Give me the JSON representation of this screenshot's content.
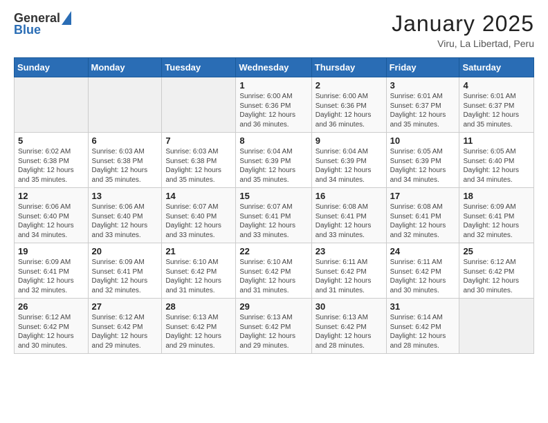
{
  "header": {
    "logo_general": "General",
    "logo_blue": "Blue",
    "month": "January 2025",
    "location": "Viru, La Libertad, Peru"
  },
  "weekdays": [
    "Sunday",
    "Monday",
    "Tuesday",
    "Wednesday",
    "Thursday",
    "Friday",
    "Saturday"
  ],
  "weeks": [
    [
      {
        "day": "",
        "info": ""
      },
      {
        "day": "",
        "info": ""
      },
      {
        "day": "",
        "info": ""
      },
      {
        "day": "1",
        "info": "Sunrise: 6:00 AM\nSunset: 6:36 PM\nDaylight: 12 hours and 36 minutes."
      },
      {
        "day": "2",
        "info": "Sunrise: 6:00 AM\nSunset: 6:36 PM\nDaylight: 12 hours and 36 minutes."
      },
      {
        "day": "3",
        "info": "Sunrise: 6:01 AM\nSunset: 6:37 PM\nDaylight: 12 hours and 35 minutes."
      },
      {
        "day": "4",
        "info": "Sunrise: 6:01 AM\nSunset: 6:37 PM\nDaylight: 12 hours and 35 minutes."
      }
    ],
    [
      {
        "day": "5",
        "info": "Sunrise: 6:02 AM\nSunset: 6:38 PM\nDaylight: 12 hours and 35 minutes."
      },
      {
        "day": "6",
        "info": "Sunrise: 6:03 AM\nSunset: 6:38 PM\nDaylight: 12 hours and 35 minutes."
      },
      {
        "day": "7",
        "info": "Sunrise: 6:03 AM\nSunset: 6:38 PM\nDaylight: 12 hours and 35 minutes."
      },
      {
        "day": "8",
        "info": "Sunrise: 6:04 AM\nSunset: 6:39 PM\nDaylight: 12 hours and 35 minutes."
      },
      {
        "day": "9",
        "info": "Sunrise: 6:04 AM\nSunset: 6:39 PM\nDaylight: 12 hours and 34 minutes."
      },
      {
        "day": "10",
        "info": "Sunrise: 6:05 AM\nSunset: 6:39 PM\nDaylight: 12 hours and 34 minutes."
      },
      {
        "day": "11",
        "info": "Sunrise: 6:05 AM\nSunset: 6:40 PM\nDaylight: 12 hours and 34 minutes."
      }
    ],
    [
      {
        "day": "12",
        "info": "Sunrise: 6:06 AM\nSunset: 6:40 PM\nDaylight: 12 hours and 34 minutes."
      },
      {
        "day": "13",
        "info": "Sunrise: 6:06 AM\nSunset: 6:40 PM\nDaylight: 12 hours and 33 minutes."
      },
      {
        "day": "14",
        "info": "Sunrise: 6:07 AM\nSunset: 6:40 PM\nDaylight: 12 hours and 33 minutes."
      },
      {
        "day": "15",
        "info": "Sunrise: 6:07 AM\nSunset: 6:41 PM\nDaylight: 12 hours and 33 minutes."
      },
      {
        "day": "16",
        "info": "Sunrise: 6:08 AM\nSunset: 6:41 PM\nDaylight: 12 hours and 33 minutes."
      },
      {
        "day": "17",
        "info": "Sunrise: 6:08 AM\nSunset: 6:41 PM\nDaylight: 12 hours and 32 minutes."
      },
      {
        "day": "18",
        "info": "Sunrise: 6:09 AM\nSunset: 6:41 PM\nDaylight: 12 hours and 32 minutes."
      }
    ],
    [
      {
        "day": "19",
        "info": "Sunrise: 6:09 AM\nSunset: 6:41 PM\nDaylight: 12 hours and 32 minutes."
      },
      {
        "day": "20",
        "info": "Sunrise: 6:09 AM\nSunset: 6:41 PM\nDaylight: 12 hours and 32 minutes."
      },
      {
        "day": "21",
        "info": "Sunrise: 6:10 AM\nSunset: 6:42 PM\nDaylight: 12 hours and 31 minutes."
      },
      {
        "day": "22",
        "info": "Sunrise: 6:10 AM\nSunset: 6:42 PM\nDaylight: 12 hours and 31 minutes."
      },
      {
        "day": "23",
        "info": "Sunrise: 6:11 AM\nSunset: 6:42 PM\nDaylight: 12 hours and 31 minutes."
      },
      {
        "day": "24",
        "info": "Sunrise: 6:11 AM\nSunset: 6:42 PM\nDaylight: 12 hours and 30 minutes."
      },
      {
        "day": "25",
        "info": "Sunrise: 6:12 AM\nSunset: 6:42 PM\nDaylight: 12 hours and 30 minutes."
      }
    ],
    [
      {
        "day": "26",
        "info": "Sunrise: 6:12 AM\nSunset: 6:42 PM\nDaylight: 12 hours and 30 minutes."
      },
      {
        "day": "27",
        "info": "Sunrise: 6:12 AM\nSunset: 6:42 PM\nDaylight: 12 hours and 29 minutes."
      },
      {
        "day": "28",
        "info": "Sunrise: 6:13 AM\nSunset: 6:42 PM\nDaylight: 12 hours and 29 minutes."
      },
      {
        "day": "29",
        "info": "Sunrise: 6:13 AM\nSunset: 6:42 PM\nDaylight: 12 hours and 29 minutes."
      },
      {
        "day": "30",
        "info": "Sunrise: 6:13 AM\nSunset: 6:42 PM\nDaylight: 12 hours and 28 minutes."
      },
      {
        "day": "31",
        "info": "Sunrise: 6:14 AM\nSunset: 6:42 PM\nDaylight: 12 hours and 28 minutes."
      },
      {
        "day": "",
        "info": ""
      }
    ]
  ]
}
